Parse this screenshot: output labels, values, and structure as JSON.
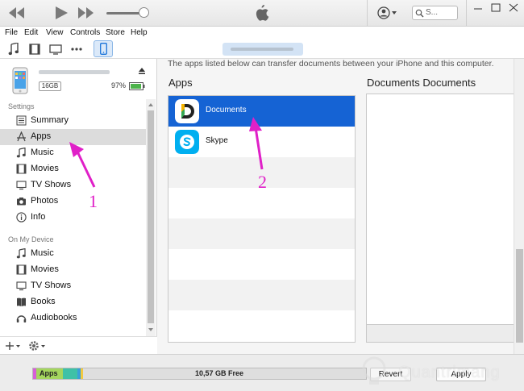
{
  "toolbar": {
    "search_placeholder": "S...",
    "menu": [
      "File",
      "Edit",
      "View",
      "Controls",
      "Store",
      "Help"
    ]
  },
  "device": {
    "capacity": "16GB",
    "battery": "97%"
  },
  "sidebar": {
    "settings_heading": "Settings",
    "settings_items": [
      {
        "label": "Summary",
        "icon": "summary-icon"
      },
      {
        "label": "Apps",
        "icon": "apps-icon",
        "selected": true
      },
      {
        "label": "Music",
        "icon": "music-note-icon"
      },
      {
        "label": "Movies",
        "icon": "film-icon"
      },
      {
        "label": "TV Shows",
        "icon": "tv-icon"
      },
      {
        "label": "Photos",
        "icon": "camera-icon"
      },
      {
        "label": "Info",
        "icon": "info-icon"
      }
    ],
    "ondevice_heading": "On My Device",
    "ondevice_items": [
      {
        "label": "Music",
        "icon": "music-note-icon"
      },
      {
        "label": "Movies",
        "icon": "film-icon"
      },
      {
        "label": "TV Shows",
        "icon": "tv-icon"
      },
      {
        "label": "Books",
        "icon": "book-icon"
      },
      {
        "label": "Audiobooks",
        "icon": "audiobook-icon"
      }
    ]
  },
  "main": {
    "intro": "The apps listed below can transfer documents between your iPhone and this computer.",
    "apps_heading": "Apps",
    "docs_heading": "Documents Documents",
    "apps": [
      {
        "name": "Documents",
        "icon": "documents-app-icon",
        "selected": true
      },
      {
        "name": "Skype",
        "icon": "skype-app-icon"
      }
    ]
  },
  "status": {
    "apps_label": "Apps",
    "free_label": "10,57 GB Free",
    "revert_label": "Revert",
    "apply_label": "Apply"
  },
  "annotations": {
    "num1": "1",
    "num2": "2",
    "color": "#e020c8"
  },
  "colors": {
    "selection": "#1563d4",
    "accent": "#1a73d9"
  }
}
